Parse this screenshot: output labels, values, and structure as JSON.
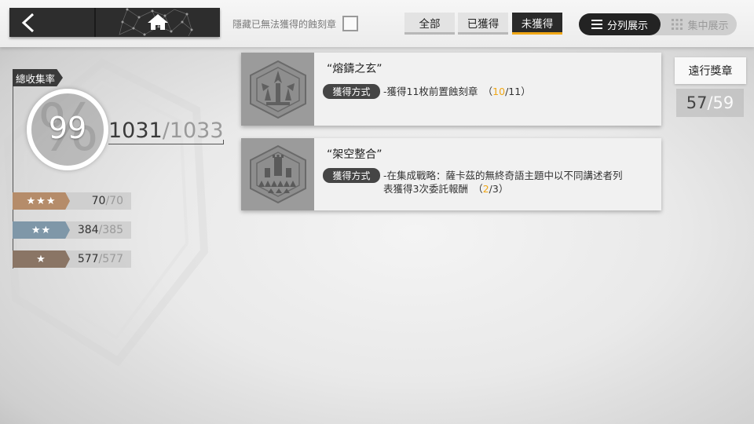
{
  "nav": {
    "back_icon": "chevron-left",
    "home_icon": "house"
  },
  "filters": {
    "hide_unobtainable_label": "隱藏已無法獲得的蝕刻章",
    "tabs": [
      {
        "label": "全部",
        "active": false
      },
      {
        "label": "已獲得",
        "active": false
      },
      {
        "label": "未獲得",
        "active": true
      }
    ]
  },
  "view_toggle": {
    "list_label": "分列展示",
    "grid_label": "集中展示",
    "active": "list"
  },
  "collection": {
    "rate_label": "總收集率",
    "rate": "99",
    "collected": "1031",
    "total": "/1033",
    "tiers": [
      {
        "stars": "★★★",
        "collected": "70",
        "total": "/70",
        "color": "#b58c6a"
      },
      {
        "stars": "★★",
        "collected": "384",
        "total": "/385",
        "color": "#7f97a8"
      },
      {
        "stars": "★",
        "collected": "577",
        "total": "/577",
        "color": "#8a7565"
      }
    ]
  },
  "medals": [
    {
      "title": "“熔鑄之玄”",
      "method_label": "獲得方式",
      "method_text": "-獲得11枚前置蝕刻章　（",
      "progress_current": "10",
      "progress_total": "/11）",
      "icon": "gothic-medal-icon"
    },
    {
      "title": "“架空整合”",
      "method_label": "獲得方式",
      "method_text": "-在集成戰略：薩卡茲的無終奇語主題中以不同講述者列\n表獲得3次委託報酬　（",
      "progress_current": "2",
      "progress_total": "/3）",
      "icon": "tower-medal-icon"
    }
  ],
  "reward": {
    "label": "遠行獎章",
    "current": "57",
    "total": "/59"
  },
  "colors": {
    "accent": "#f0a716",
    "dark": "#2a2a2a"
  }
}
